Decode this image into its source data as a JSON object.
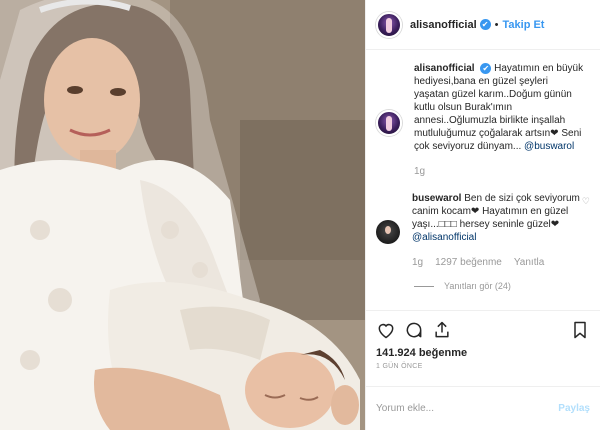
{
  "header": {
    "username": "alisanofficial",
    "verified_mark": "✔",
    "separator": "•",
    "follow_label": "Takip Et"
  },
  "caption": {
    "username": "alisanofficial",
    "text": "Hayatımın en büyük hediyesi,bana en güzel şeyleri yaşatan güzel karım..Doğum günün kutlu olsun Burak'ımın annesi..Oğlumuzla birlikte inşallah mutluluğumuz çoğalarak artsın❤ Seni çok seviyoruz dünyam...",
    "mention": "@buswarol",
    "time": "1g"
  },
  "reply": {
    "username": "busewarol",
    "text": "Ben de sizi çok seviyorum canim kocam❤ Hayatımın en güzel yaşı...□□□ hersey seninle güzel❤",
    "mention": "@alisanofficial",
    "time": "1g",
    "likes": "1297 beğenme",
    "reply_label": "Yanıtla",
    "view_replies": "Yanıtları gör (24)"
  },
  "actions": {
    "likes_count": "141.924 beğenme",
    "age": "1 GÜN ÖNCE"
  },
  "comment_box": {
    "placeholder": "Yorum ekle...",
    "post_label": "Paylaş"
  },
  "colors": {
    "accent": "#3897f0",
    "post_disabled": "#b2dffc",
    "muted": "#999999"
  },
  "icons": [
    "heart-icon",
    "comment-icon",
    "share-icon",
    "bookmark-icon",
    "small-heart-icon"
  ]
}
